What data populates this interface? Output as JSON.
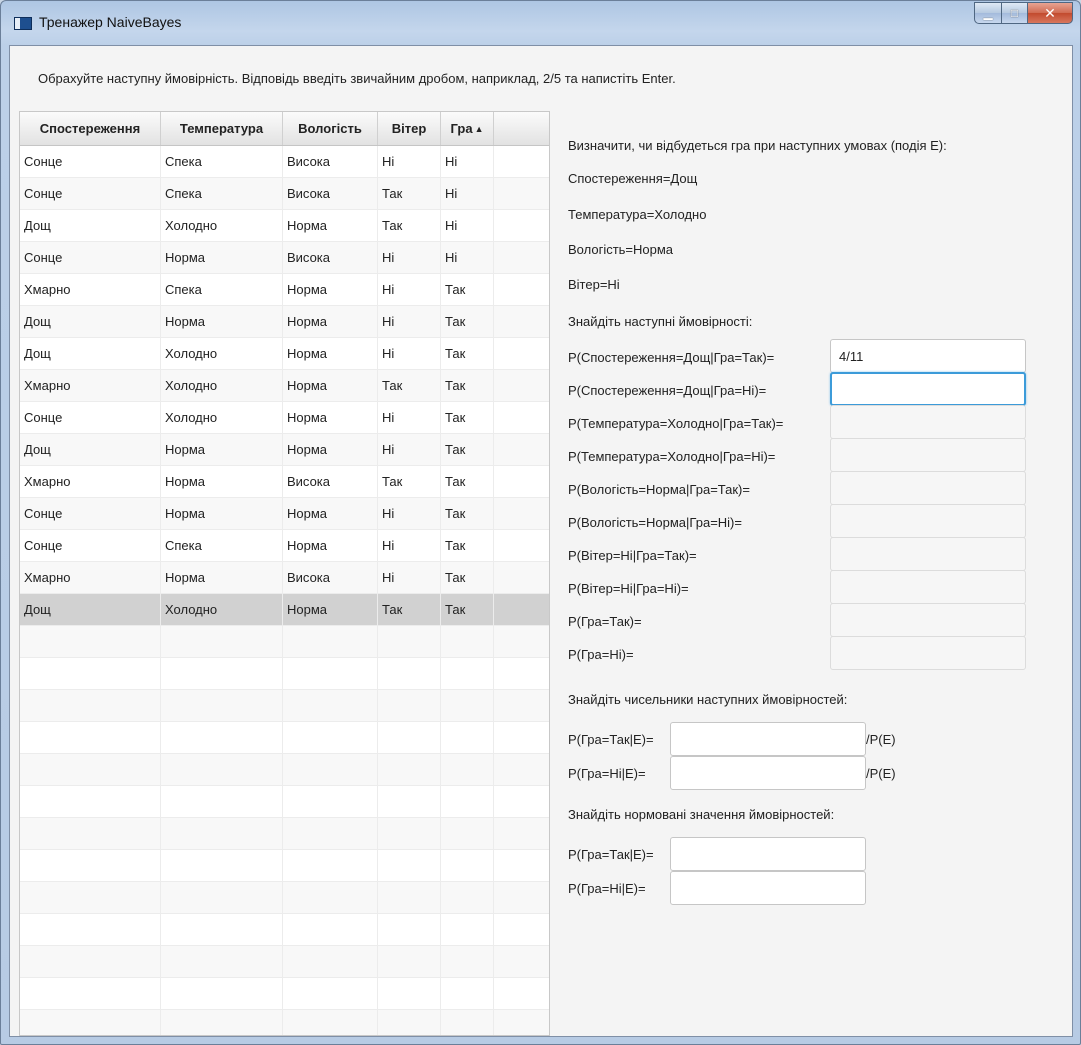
{
  "window": {
    "title": "Тренажер NaiveBayes"
  },
  "instruction": "Обрахуйте наступну ймовірність. Відповідь введіть звичайним дробом, наприклад, 2/5 та напистіть Enter.",
  "table": {
    "headers": [
      "Спостереження",
      "Температура",
      "Вологість",
      "Вітер",
      "Гра"
    ],
    "sort_indicator": "▲",
    "rows": [
      [
        "Сонце",
        "Спека",
        "Висока",
        "Ні",
        "Ні"
      ],
      [
        "Сонце",
        "Спека",
        "Висока",
        "Так",
        "Ні"
      ],
      [
        "Дощ",
        "Холодно",
        "Норма",
        "Так",
        "Ні"
      ],
      [
        "Сонце",
        "Норма",
        "Висока",
        "Ні",
        "Ні"
      ],
      [
        "Хмарно",
        "Спека",
        "Норма",
        "Ні",
        "Так"
      ],
      [
        "Дощ",
        "Норма",
        "Норма",
        "Ні",
        "Так"
      ],
      [
        "Дощ",
        "Холодно",
        "Норма",
        "Ні",
        "Так"
      ],
      [
        "Хмарно",
        "Холодно",
        "Норма",
        "Так",
        "Так"
      ],
      [
        "Сонце",
        "Холодно",
        "Норма",
        "Ні",
        "Так"
      ],
      [
        "Дощ",
        "Норма",
        "Норма",
        "Ні",
        "Так"
      ],
      [
        "Хмарно",
        "Норма",
        "Висока",
        "Так",
        "Так"
      ],
      [
        "Сонце",
        "Норма",
        "Норма",
        "Ні",
        "Так"
      ],
      [
        "Сонце",
        "Спека",
        "Норма",
        "Ні",
        "Так"
      ],
      [
        "Хмарно",
        "Норма",
        "Висока",
        "Ні",
        "Так"
      ],
      [
        "Дощ",
        "Холодно",
        "Норма",
        "Так",
        "Так"
      ]
    ],
    "selected_row": 15
  },
  "conditions": {
    "heading": "Визначити, чи відбудеться гра при наступних умовах (подія Е):",
    "lines": [
      "Спостереження=Дощ",
      "Температура=Холодно",
      "Вологість=Норма",
      "Вітер=Ні"
    ]
  },
  "probs": {
    "heading": "Знайдіть наступні ймовірності:",
    "items": [
      {
        "label": "P(Спостереження=Дощ|Гра=Так)=",
        "value": "4/11"
      },
      {
        "label": "P(Спостереження=Дощ|Гра=Ні)=",
        "value": ""
      },
      {
        "label": "P(Температура=Холодно|Гра=Так)=",
        "value": ""
      },
      {
        "label": "P(Температура=Холодно|Гра=Ні)=",
        "value": ""
      },
      {
        "label": "P(Вологість=Норма|Гра=Так)=",
        "value": ""
      },
      {
        "label": "P(Вологість=Норма|Гра=Ні)=",
        "value": ""
      },
      {
        "label": "P(Вітер=Ні|Гра=Так)=",
        "value": ""
      },
      {
        "label": "P(Вітер=Ні|Гра=Ні)=",
        "value": ""
      },
      {
        "label": "P(Гра=Так)=",
        "value": ""
      },
      {
        "label": "P(Гра=Ні)=",
        "value": ""
      }
    ]
  },
  "numerators": {
    "heading": "Знайдіть чисельники наступних ймовірностей:",
    "items": [
      {
        "label": "P(Гра=Так|E)=",
        "suffix": "/P(E)"
      },
      {
        "label": "P(Гра=Ні|E)=",
        "suffix": "/P(E)"
      }
    ]
  },
  "normalized": {
    "heading": "Знайдіть нормовані значення ймовірностей:",
    "items": [
      {
        "label": "P(Гра=Так|E)="
      },
      {
        "label": "P(Гра=Ні|E)="
      }
    ]
  }
}
